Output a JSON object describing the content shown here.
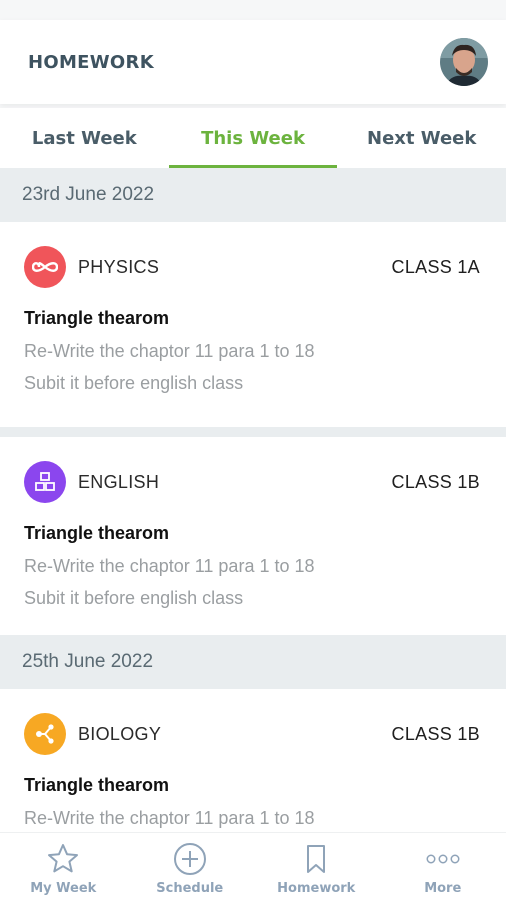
{
  "header": {
    "title": "HOMEWORK"
  },
  "tabs": [
    {
      "label": "Last Week",
      "active": false
    },
    {
      "label": "This Week",
      "active": true
    },
    {
      "label": "Next Week",
      "active": false
    }
  ],
  "groups": [
    {
      "date": "23rd June 2022",
      "items": [
        {
          "subject": "PHYSICS",
          "class": "CLASS 1A",
          "icon": "infinity-icon",
          "icon_color": "#f0555a",
          "title": "Triangle thearom",
          "line1": "Re-Write the chaptor 11 para 1 to 18",
          "line2": "Subit it before english class"
        },
        {
          "subject": "ENGLISH",
          "class": "CLASS 1B",
          "icon": "blocks-icon",
          "icon_color": "#8b46ee",
          "title": "Triangle thearom",
          "line1": "Re-Write the chaptor 11 para 1 to 18",
          "line2": "Subit it before english class"
        }
      ]
    },
    {
      "date": "25th June 2022",
      "items": [
        {
          "subject": "BIOLOGY",
          "class": "CLASS 1B",
          "icon": "molecule-icon",
          "icon_color": "#f7a823",
          "title": "Triangle thearom",
          "line1": "Re-Write the chaptor 11 para 1 to 18"
        }
      ]
    }
  ],
  "bottom_nav": [
    {
      "label": "My Week",
      "icon": "star-icon"
    },
    {
      "label": "Schedule",
      "icon": "plus-circle-icon"
    },
    {
      "label": "Homework",
      "icon": "bookmark-icon"
    },
    {
      "label": "More",
      "icon": "more-dots-icon"
    }
  ],
  "colors": {
    "accent": "#6cb33e",
    "nav": "#8fa3b8",
    "header_text": "#3e5360"
  }
}
